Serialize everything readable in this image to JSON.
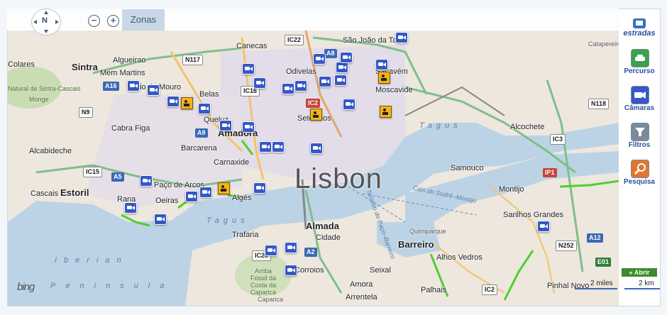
{
  "map": {
    "toolbar": {
      "compass_label": "N",
      "zoom_out": "−",
      "zoom_in": "+",
      "zonas_label": "Zonas"
    },
    "city_label": "Lisbon",
    "places": [
      "Colares",
      "Sintra",
      "Algueirao",
      "Mem Martins",
      "Rio de Mouro",
      "Belas",
      "Canecas",
      "São João da Talha",
      "Odivelas",
      "Sacavém",
      "Moscavide",
      "Natural de Sintra-Cascais",
      "Monge",
      "Cabra Figa",
      "Queluz",
      "Amadora",
      "Sete Rios",
      "Alcochete",
      "Barcarena",
      "Carnaxide",
      "Alcabideche",
      "Samouco",
      "Estoril",
      "Rana",
      "Paço de Arcos",
      "Algés",
      "Montijo",
      "Cascais",
      "Oeiras",
      "Sarilhos Grandes",
      "Trafaria",
      "Almada",
      "Quimiparque",
      "Barreiro",
      "Alhos Vedros",
      "Seixal",
      "Corroios",
      "Arrentela",
      "Amora",
      "Palhais",
      "Pinhal Novo",
      "Catapereiro",
      "Caparica",
      "Arriba Fóssil da Costa da Caparica",
      "Cidade"
    ],
    "water_labels": [
      "Tagus",
      "Tagus",
      "Iberian",
      "Peninsula"
    ],
    "small_labels": [
      "Cais do Sodré–Montijo",
      "Terreiro do Paço–Barreiro"
    ],
    "road_shields": [
      {
        "text": "IC22",
        "style": "white"
      },
      {
        "text": "N117",
        "style": "white"
      },
      {
        "text": "A16",
        "style": "blue"
      },
      {
        "text": "N9",
        "style": "white"
      },
      {
        "text": "IC16",
        "style": "white"
      },
      {
        "text": "A8",
        "style": "blue"
      },
      {
        "text": "IC2",
        "style": "red"
      },
      {
        "text": "A9",
        "style": "blue"
      },
      {
        "text": "IC15",
        "style": "white"
      },
      {
        "text": "A5",
        "style": "blue"
      },
      {
        "text": "N118",
        "style": "white"
      },
      {
        "text": "IC3",
        "style": "white"
      },
      {
        "text": "IP1",
        "style": "red"
      },
      {
        "text": "N252",
        "style": "white"
      },
      {
        "text": "A12",
        "style": "blue"
      },
      {
        "text": "E01",
        "style": "green"
      },
      {
        "text": "IC20",
        "style": "white"
      },
      {
        "text": "A2",
        "style": "blue"
      },
      {
        "text": "IC2",
        "style": "white"
      }
    ],
    "scale": {
      "miles": "2 miles",
      "km": "2 km"
    },
    "branding": "bing"
  },
  "sidebar": {
    "logo": "estradas",
    "buttons": [
      {
        "label": "Percurso",
        "color": "#3aa24a",
        "icon": "car-icon"
      },
      {
        "label": "Câmaras",
        "color": "#3558c8",
        "icon": "camera-icon"
      },
      {
        "label": "Filtros",
        "color": "#7a8a99",
        "icon": "funnel-icon"
      },
      {
        "label": "Pesquisa",
        "color": "#e2762f",
        "icon": "magnifier-icon"
      }
    ],
    "abrir_label": "« Abrir"
  }
}
